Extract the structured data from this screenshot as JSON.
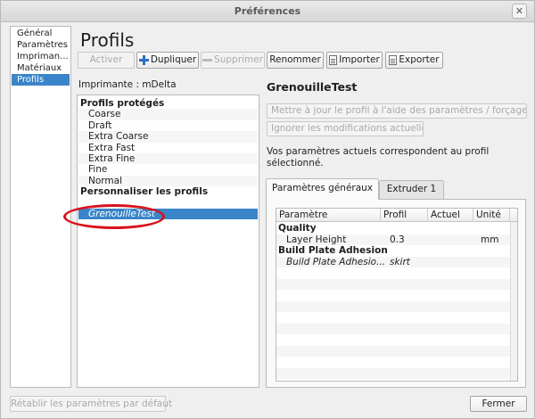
{
  "window": {
    "title": "Préférences",
    "close_glyph": "✕"
  },
  "sidebar": {
    "items": [
      {
        "label": "Général"
      },
      {
        "label": "Paramètres"
      },
      {
        "label": "Impriman..."
      },
      {
        "label": "Matériaux"
      },
      {
        "label": "Profils"
      }
    ],
    "selected": "Profils"
  },
  "page": {
    "title": "Profils"
  },
  "toolbar": {
    "activate": "Activer",
    "duplicate": "Dupliquer",
    "remove": "Supprimer",
    "rename": "Renommer",
    "import": "Importer",
    "export": "Exporter"
  },
  "printer_label": "Imprimante : mDelta",
  "profiles": {
    "protected_header": "Profils protégés",
    "protected": [
      "Coarse",
      "Draft",
      "Extra Coarse",
      "Extra Fast",
      "Extra Fine",
      "Fine",
      "Normal"
    ],
    "custom_header": "Personnaliser les profils",
    "custom": [
      "GrenouilleTest"
    ],
    "selected": "GrenouilleTest"
  },
  "detail": {
    "profile_name": "GrenouilleTest",
    "update_button": "Mettre à jour le profil à l'aide des paramètres / forçages actuels",
    "discard_button": "Ignorer les modifications actuelles",
    "note": "Vos paramètres actuels correspondent au profil sélectionné.",
    "tabs": [
      {
        "label": "Paramètres généraux"
      },
      {
        "label": "Extruder 1"
      }
    ],
    "table": {
      "headers": [
        "Paramètre",
        "Profil",
        "Actuel",
        "Unité"
      ],
      "rows": [
        {
          "section": "Quality"
        },
        {
          "param": "Layer Height",
          "profile": "0.3",
          "current": "",
          "unit": "mm"
        },
        {
          "section": "Build Plate Adhesion"
        },
        {
          "param": "Build Plate Adhesio...",
          "profile": "skirt",
          "current": "",
          "unit": ""
        }
      ]
    }
  },
  "footer": {
    "reset": "Rétablir les paramètres par défaut",
    "close": "Fermer"
  },
  "colors": {
    "selection": "#3a84c9",
    "annotation": "#d9121c"
  }
}
